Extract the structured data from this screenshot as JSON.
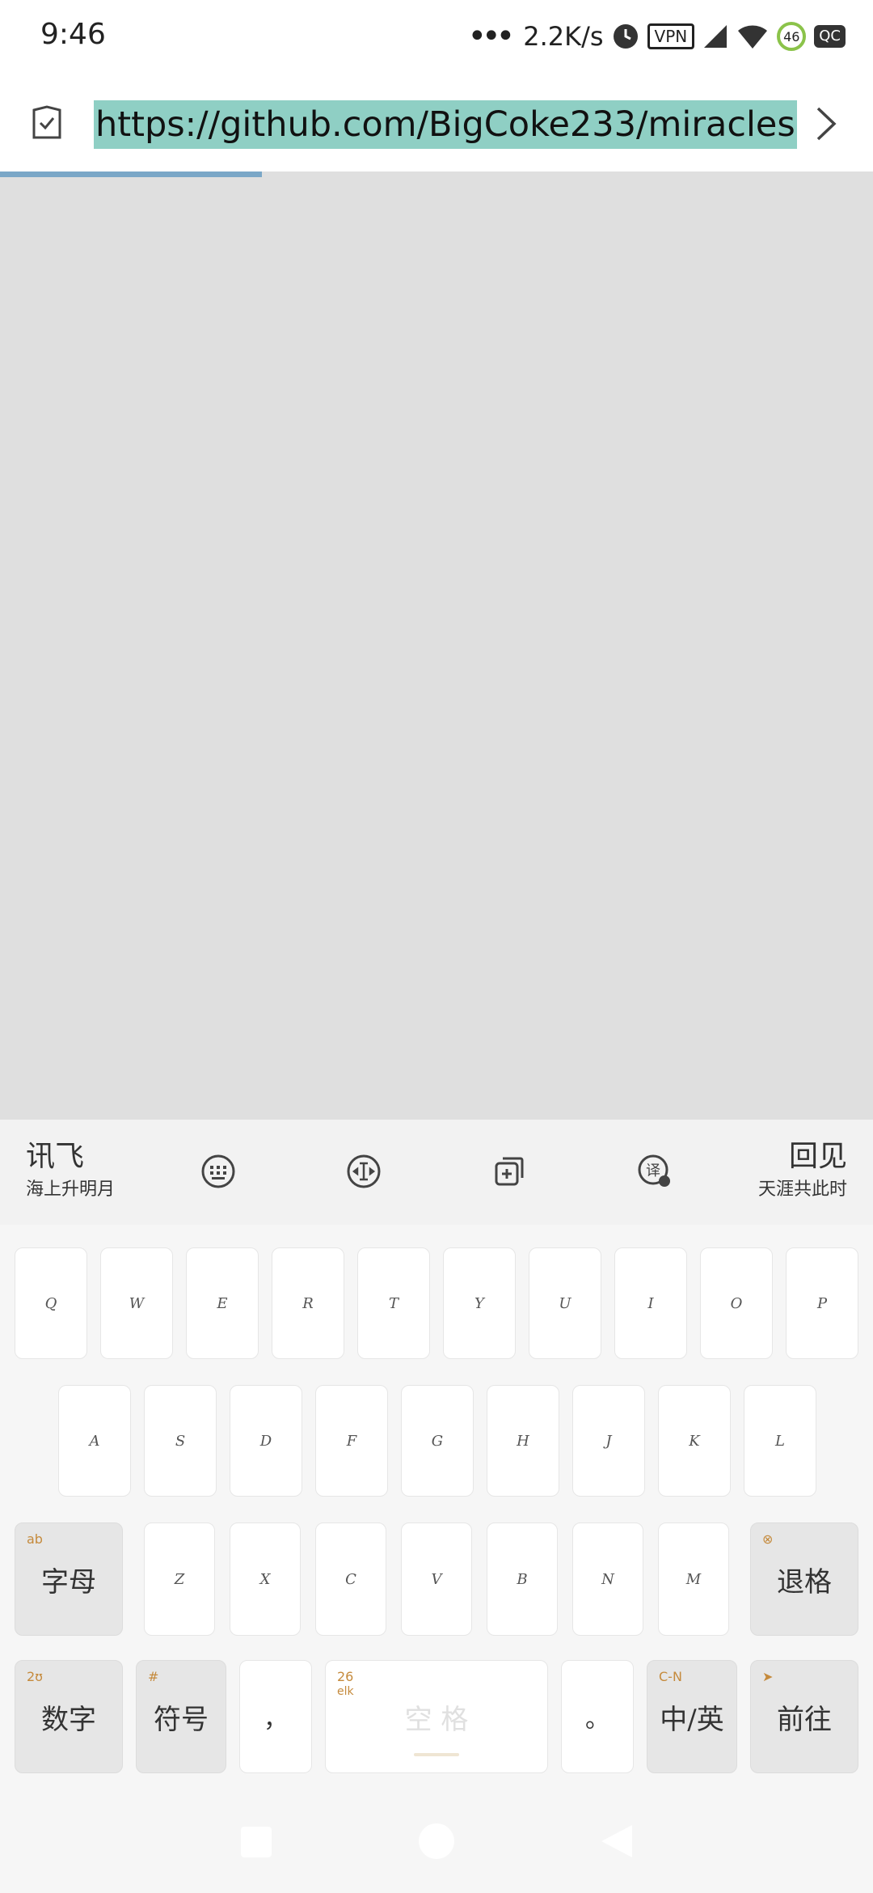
{
  "status_bar": {
    "time": "9:46",
    "network_speed": "2.2K/s",
    "vpn": "VPN",
    "battery": "46",
    "qc": "QC"
  },
  "browser": {
    "url": "https://github.com/BigCoke233/miracles",
    "load_progress": 0.3
  },
  "keyboard": {
    "brand_left": "讯飞",
    "brand_left_sub": "海上升明月",
    "brand_right": "回见",
    "brand_right_sub": "天涯共此时",
    "toolbar_icons": [
      "keyboard-icon",
      "cursor-icon",
      "clipboard-icon",
      "translate-icon"
    ],
    "row1": [
      "Q",
      "W",
      "E",
      "R",
      "T",
      "Y",
      "U",
      "I",
      "O",
      "P"
    ],
    "row2": [
      "A",
      "S",
      "D",
      "F",
      "G",
      "H",
      "J",
      "K",
      "L"
    ],
    "row3": [
      "Z",
      "X",
      "C",
      "V",
      "B",
      "N",
      "M"
    ],
    "letters_key": "字母",
    "letters_key_hint": "ab",
    "backspace_key": "退格",
    "numbers_key": "数字",
    "numbers_key_hint": "2ʊ",
    "symbols_key": "符号",
    "symbols_key_hint": "#",
    "comma_key": "，",
    "space_key": "空 格",
    "space_hint_top": "26",
    "space_hint_bottom": "elk",
    "period_key": "。",
    "lang_key": "中/英",
    "lang_key_hint": "C-N",
    "go_key": "前往"
  },
  "colors": {
    "url_highlight": "#8fcfc4",
    "progress": "#7aa7c7",
    "key_hint": "#c58a3c"
  }
}
